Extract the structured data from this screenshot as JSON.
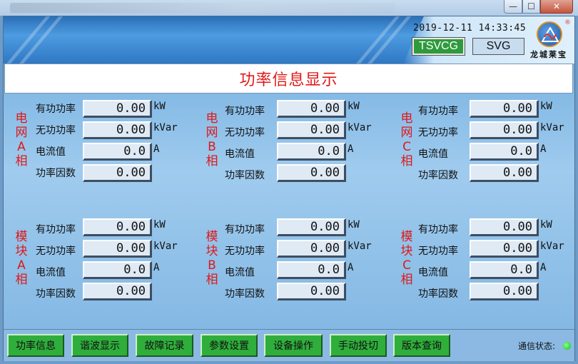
{
  "window": {
    "minimize_glyph": "—",
    "maximize_glyph": "☐",
    "close_glyph": "✕"
  },
  "header": {
    "datetime": "2019-12-11  14:33:45",
    "tabs": [
      {
        "label": "TSVCG",
        "active": true
      },
      {
        "label": "SVG",
        "active": false
      }
    ],
    "brand": "龙城莱宝",
    "registered": "®",
    "logo_icon": "brand-logo-icon"
  },
  "page_title": "功率信息显示",
  "groups": [
    {
      "label": "电网A相",
      "fields": [
        {
          "label": "有功功率",
          "value": "0.00",
          "unit": "kW"
        },
        {
          "label": "无功功率",
          "value": "0.00",
          "unit": "kVar"
        },
        {
          "label": "电流值",
          "value": "0.0",
          "unit": "A"
        },
        {
          "label": "功率因数",
          "value": "0.00",
          "unit": ""
        }
      ]
    },
    {
      "label": "电网B相",
      "fields": [
        {
          "label": "有功功率",
          "value": "0.00",
          "unit": "kW"
        },
        {
          "label": "无功功率",
          "value": "0.00",
          "unit": "kVar"
        },
        {
          "label": "电流值",
          "value": "0.0",
          "unit": "A"
        },
        {
          "label": "功率因数",
          "value": "0.00",
          "unit": ""
        }
      ]
    },
    {
      "label": "电网C相",
      "fields": [
        {
          "label": "有功功率",
          "value": "0.00",
          "unit": "kW"
        },
        {
          "label": "无功功率",
          "value": "0.00",
          "unit": "kVar"
        },
        {
          "label": "电流值",
          "value": "0.0",
          "unit": "A"
        },
        {
          "label": "功率因数",
          "value": "0.00",
          "unit": ""
        }
      ]
    },
    {
      "label": "模块A相",
      "fields": [
        {
          "label": "有功功率",
          "value": "0.00",
          "unit": "kW"
        },
        {
          "label": "无功功率",
          "value": "0.00",
          "unit": "kVar"
        },
        {
          "label": "电流值",
          "value": "0.0",
          "unit": "A"
        },
        {
          "label": "功率因数",
          "value": "0.00",
          "unit": ""
        }
      ]
    },
    {
      "label": "模块B相",
      "fields": [
        {
          "label": "有功功率",
          "value": "0.00",
          "unit": "kW"
        },
        {
          "label": "无功功率",
          "value": "0.00",
          "unit": "kVar"
        },
        {
          "label": "电流值",
          "value": "0.0",
          "unit": "A"
        },
        {
          "label": "功率因数",
          "value": "0.00",
          "unit": ""
        }
      ]
    },
    {
      "label": "模块C相",
      "fields": [
        {
          "label": "有功功率",
          "value": "0.00",
          "unit": "kW"
        },
        {
          "label": "无功功率",
          "value": "0.00",
          "unit": "kVar"
        },
        {
          "label": "电流值",
          "value": "0.0",
          "unit": "A"
        },
        {
          "label": "功率因数",
          "value": "0.00",
          "unit": ""
        }
      ]
    }
  ],
  "nav_buttons": [
    "功率信息",
    "谐波显示",
    "故障记录",
    "参数设置",
    "设备操作",
    "手动投切",
    "版本查询"
  ],
  "status": {
    "label": "通信状态:",
    "color": "#10c010"
  },
  "colors": {
    "accent_red": "#e01818",
    "button_green": "#2fae3c",
    "active_tab_green": "#2f9a3c"
  }
}
